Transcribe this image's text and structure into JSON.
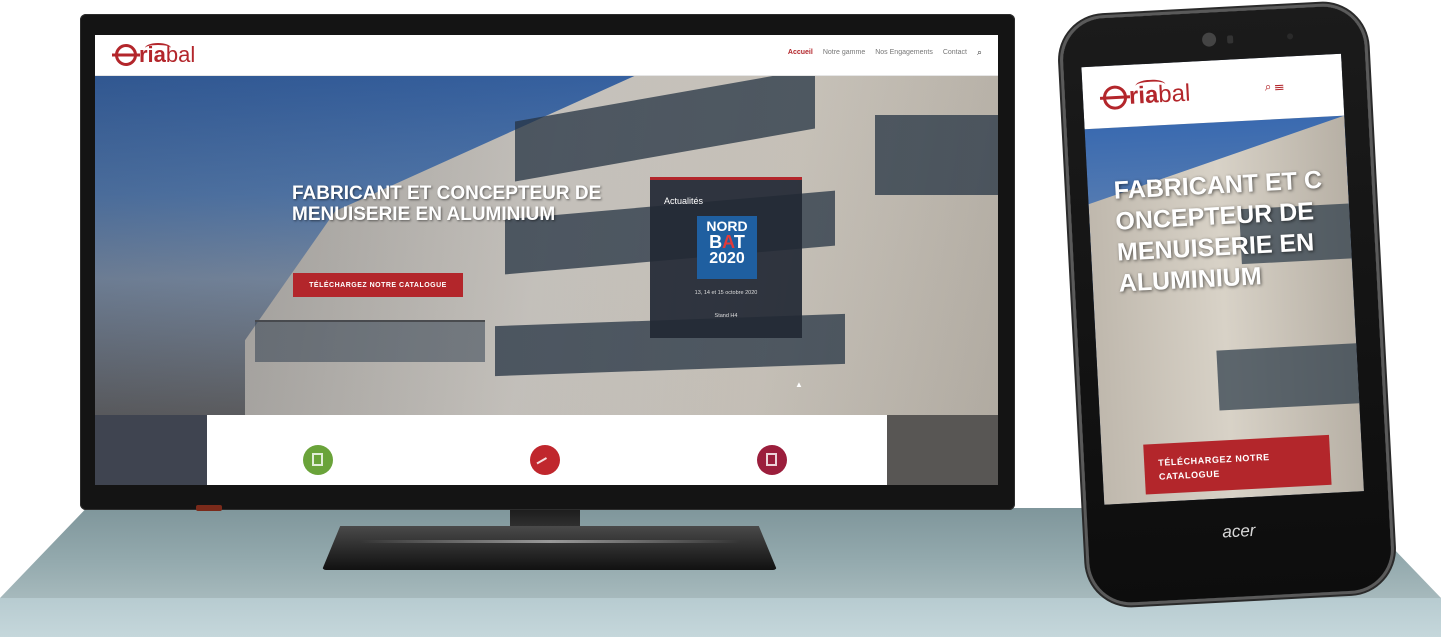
{
  "brand": {
    "logo_o": "O",
    "logo_ria": "ria",
    "logo_bal": "bal"
  },
  "nav": {
    "items": [
      {
        "label": "Accueil",
        "active": true
      },
      {
        "label": "Notre gamme",
        "active": false
      },
      {
        "label": "Nos Engagements",
        "active": false
      },
      {
        "label": "Contact",
        "active": false
      }
    ],
    "search_icon": "search-icon"
  },
  "hero": {
    "title": "FABRICANT ET CONCEPTEUR DE MENUISERIE EN ALUMINIUM",
    "cta_label": "TÉLÉCHARGEZ NOTRE CATALOGUE"
  },
  "news": {
    "heading": "Actualités",
    "badge_line1": "NORD",
    "badge_b": "B",
    "badge_a": "A",
    "badge_t": "T",
    "badge_year": "2020",
    "dates": "13, 14 et 15 octobre 2020",
    "stand": "Stand H4"
  },
  "features": [
    {
      "icon": "window-icon",
      "color": "#6aa33a"
    },
    {
      "icon": "sliding-icon",
      "color": "#c0272d"
    },
    {
      "icon": "door-icon",
      "color": "#9b1e3c"
    }
  ],
  "mobile": {
    "title": "FABRICANT ET CONCEPTEUR DE MENUISERIE EN ALUMINIUM",
    "cta_label": "TÉLÉCHARGEZ NOTRE CATALOGUE",
    "menu_icon": "hamburger-icon"
  },
  "device_brand": "acer",
  "colors": {
    "accent": "#b3262b",
    "news_badge": "#1f5fa0"
  }
}
